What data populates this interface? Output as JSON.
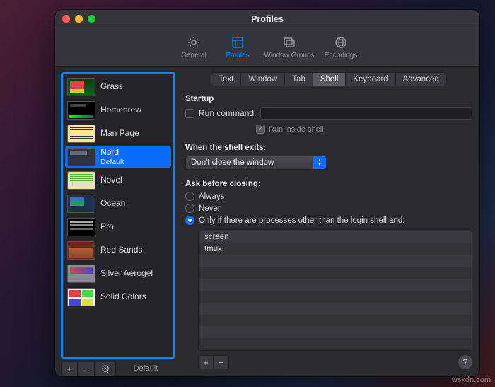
{
  "title": "Profiles",
  "toolbar": [
    {
      "id": "general",
      "label": "General",
      "icon": "gear"
    },
    {
      "id": "profiles",
      "label": "Profiles",
      "icon": "profile",
      "active": true
    },
    {
      "id": "groups",
      "label": "Window Groups",
      "icon": "stack"
    },
    {
      "id": "encodings",
      "label": "Encodings",
      "icon": "globe"
    }
  ],
  "profiles": [
    {
      "name": "Grass",
      "thumb": "grass"
    },
    {
      "name": "Homebrew",
      "thumb": "homebrew"
    },
    {
      "name": "Man Page",
      "thumb": "manpage"
    },
    {
      "name": "Nord",
      "sub": "Default",
      "thumb": "nord",
      "selected": true
    },
    {
      "name": "Novel",
      "thumb": "novel"
    },
    {
      "name": "Ocean",
      "thumb": "ocean"
    },
    {
      "name": "Pro",
      "thumb": "pro"
    },
    {
      "name": "Red Sands",
      "thumb": "redsands"
    },
    {
      "name": "Silver Aerogel",
      "thumb": "silver"
    },
    {
      "name": "Solid Colors",
      "thumb": "solid"
    }
  ],
  "sidebar_footer": {
    "default_label": "Default"
  },
  "tabs": [
    "Text",
    "Window",
    "Tab",
    "Shell",
    "Keyboard",
    "Advanced"
  ],
  "active_tab": "Shell",
  "shell": {
    "startup_hdr": "Startup",
    "run_command_label": "Run command:",
    "run_inside_label": "Run inside shell",
    "exit_hdr": "When the shell exits:",
    "exit_option": "Don't close the window",
    "ask_hdr": "Ask before closing:",
    "radios": {
      "always": "Always",
      "never": "Never",
      "onlyif": "Only if there are processes other than the login shell and:"
    },
    "selected_radio": "onlyif",
    "processes": [
      "screen",
      "tmux"
    ]
  },
  "watermark": "wskdn.com"
}
